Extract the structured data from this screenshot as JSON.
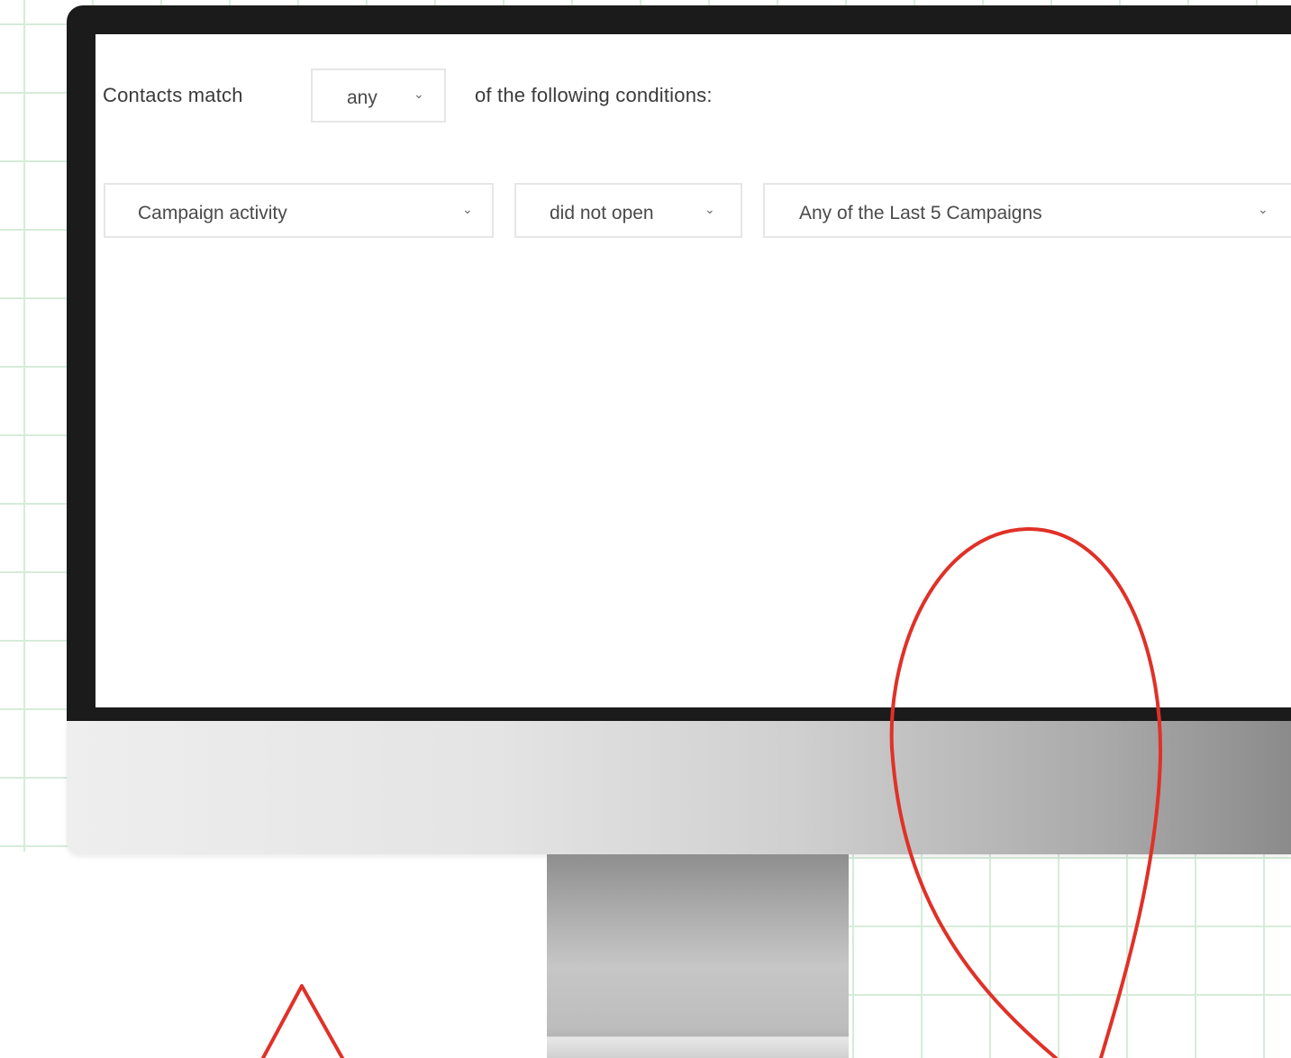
{
  "segment_builder": {
    "match_prefix": "Contacts match",
    "match_operator": "any",
    "match_suffix": "of the following conditions:",
    "condition": {
      "field": "Campaign activity",
      "operator": "did not open",
      "value": "Any of the Last 5 Campaigns"
    }
  },
  "icons": {
    "dropdown": "chevron-down-icon"
  },
  "colors": {
    "grid": "#d6ecd9",
    "bezel": "#1b1b1c",
    "annotation": "#e03128"
  }
}
